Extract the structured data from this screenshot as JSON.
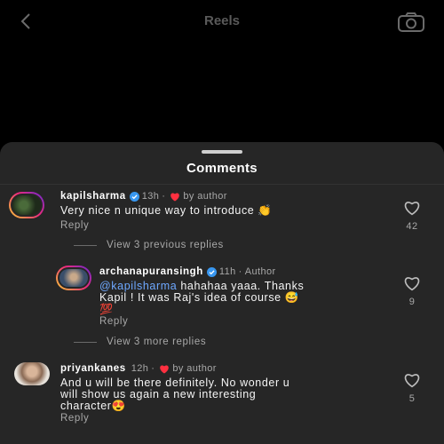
{
  "topbar": {
    "title": "Reels"
  },
  "sheet": {
    "title": "Comments"
  },
  "comments": [
    {
      "username": "kapilsharma",
      "time": "13h",
      "dot": "·",
      "liked_by": "by author",
      "text": "Very nice n unique way to introduce 👏",
      "reply_label": "Reply",
      "likes": "42"
    },
    {
      "username": "priyankanes",
      "time": "12h",
      "dot": "·",
      "liked_by": "by author",
      "text_line1": "And u will be there definitely. No wonder u",
      "text_line2": "will show us again a new interesting",
      "text_line3": "character😍",
      "reply_label": "Reply",
      "likes": "5"
    }
  ],
  "view_previous": "View 3 previous replies",
  "view_more": "View 3 more replies",
  "reply": {
    "username": "archanapuransingh",
    "time": "11h",
    "dot": "·",
    "author_tag": "Author",
    "mention": "@kapilsharma",
    "text_line1_rest": " hahahaa yaaa. Thanks",
    "text_line2": "Kapil ! It was Raj's idea of course 😅",
    "text_line3": "💯",
    "reply_label": "Reply",
    "likes": "9"
  },
  "colors": {
    "sheet_bg": "#262626",
    "heart_red": "#ff3040",
    "verified_blue": "#3897f0",
    "mention_blue": "#6ea8ff"
  }
}
